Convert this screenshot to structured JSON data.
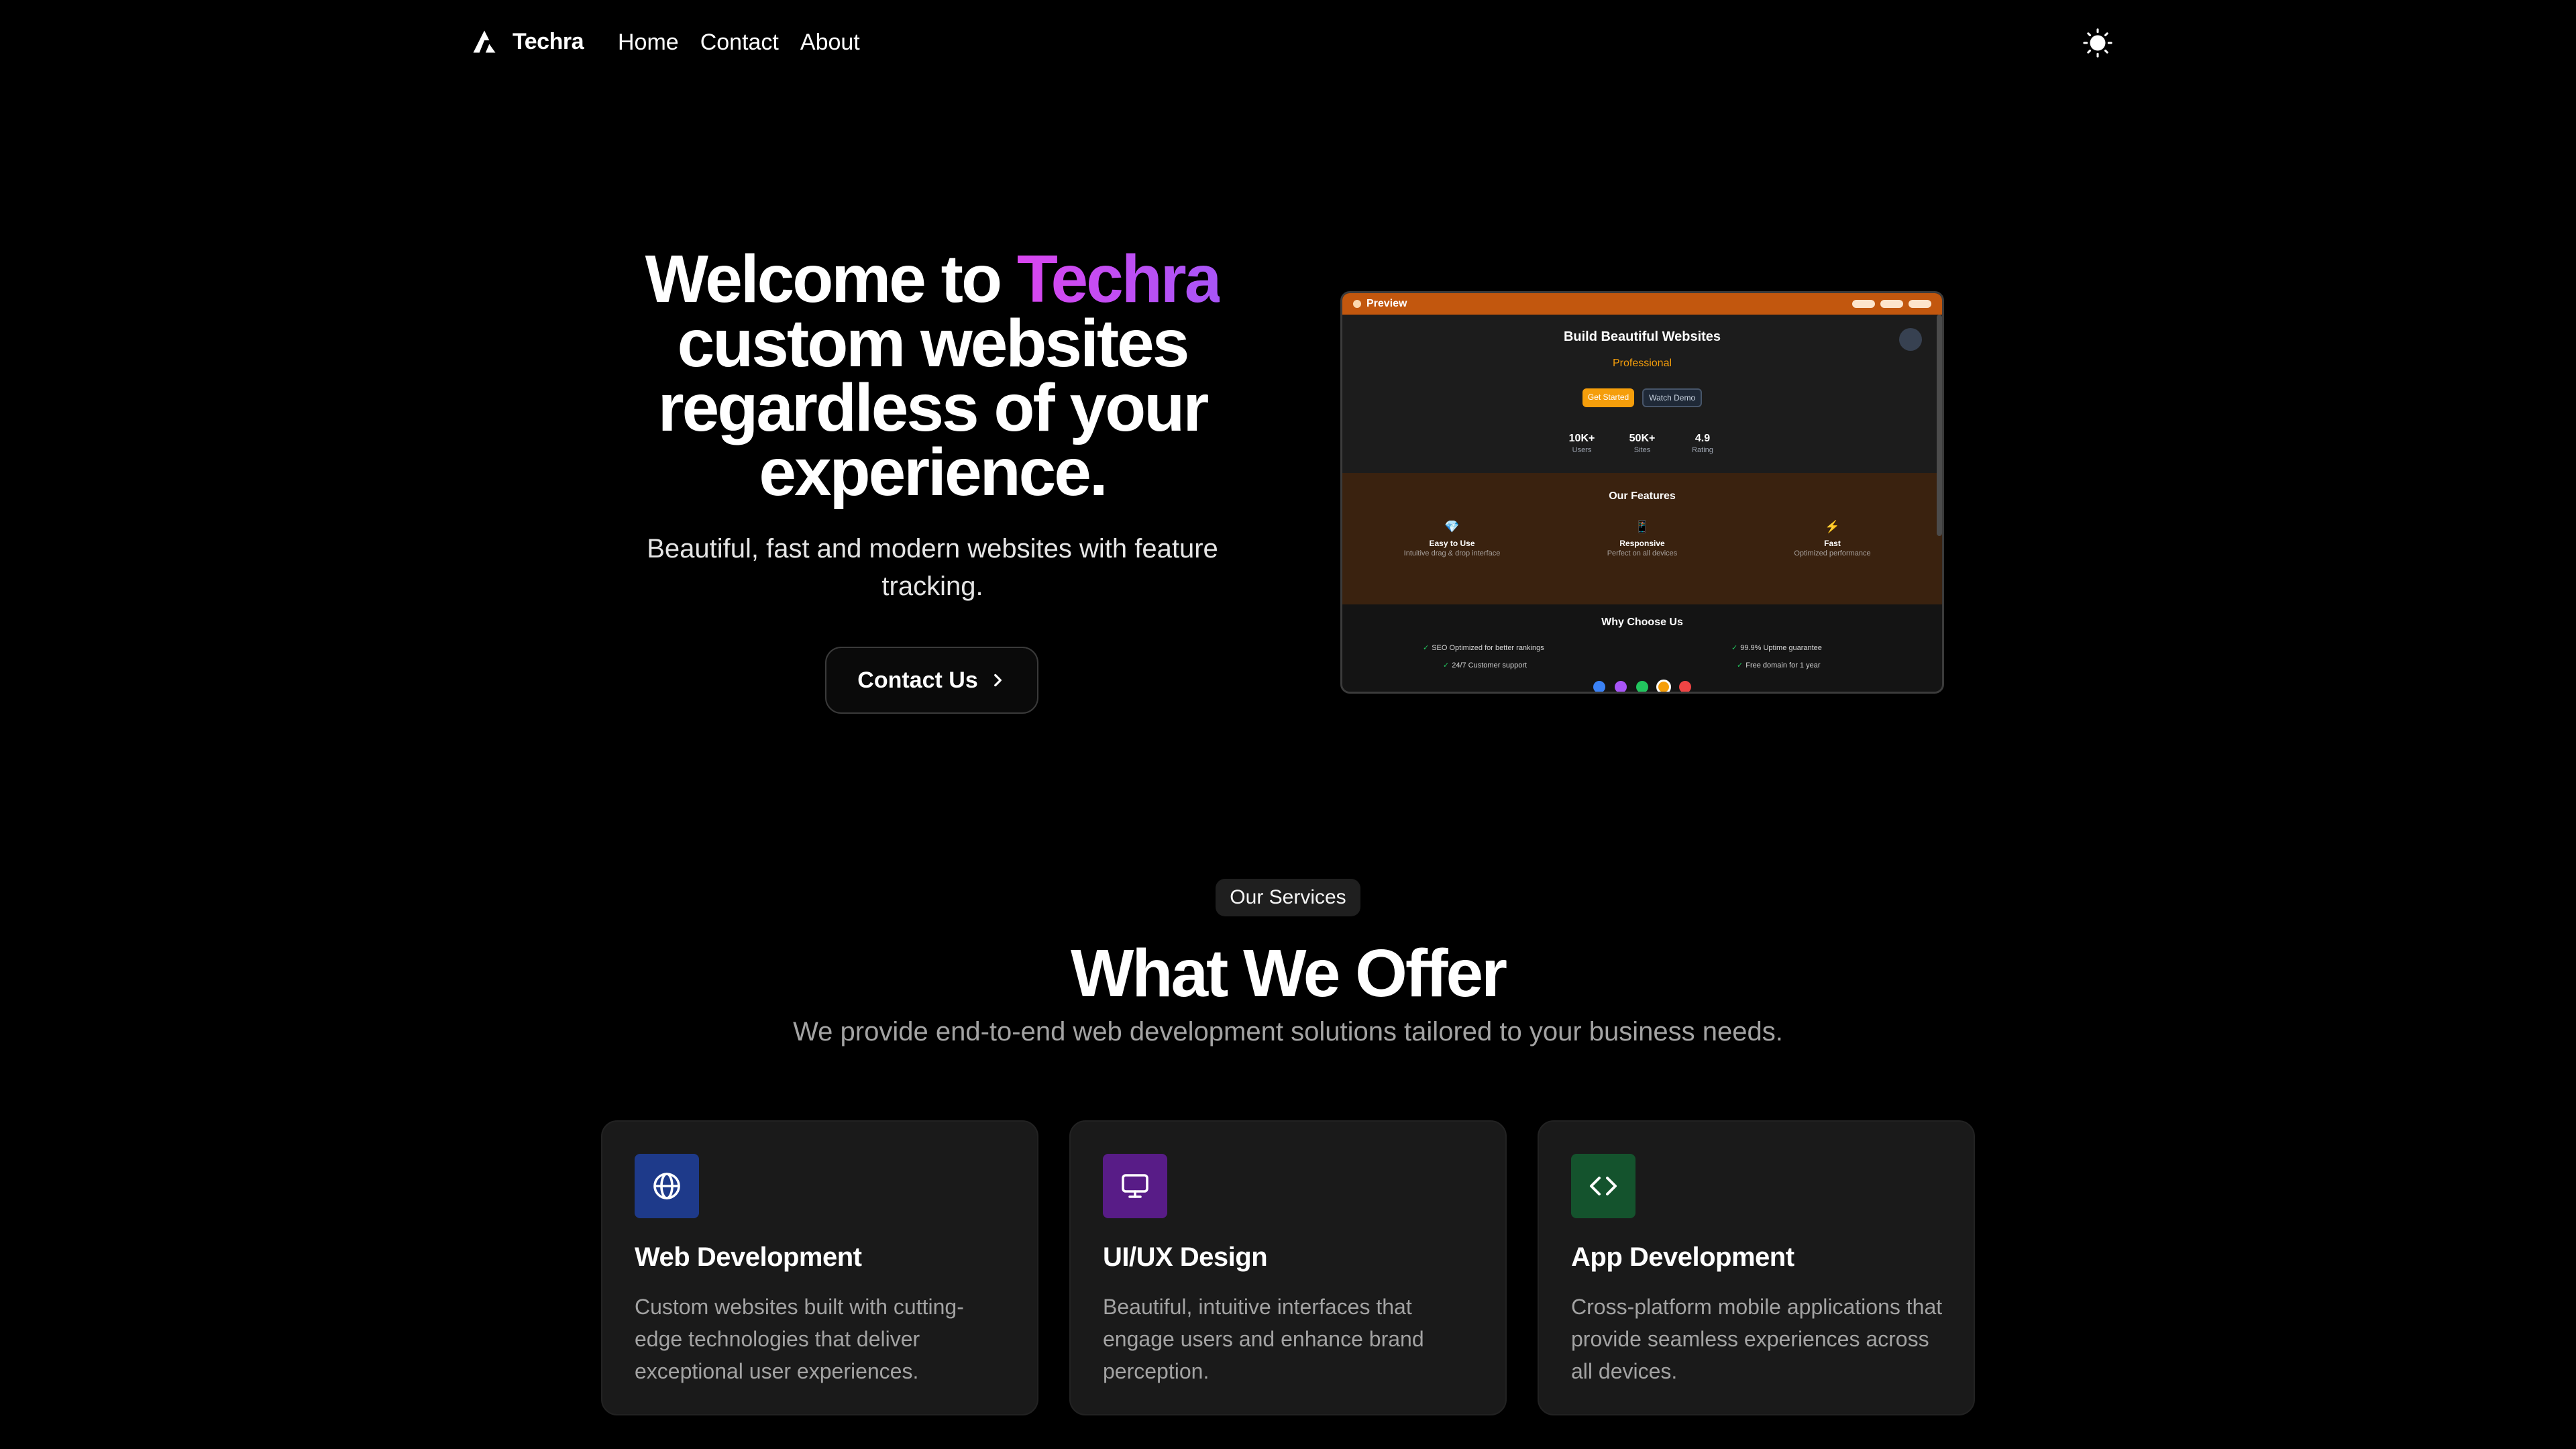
{
  "nav": {
    "brand": "Techra",
    "links": [
      "Home",
      "Contact",
      "About"
    ],
    "icons": {
      "logo": "techra-logo-icon",
      "theme": "sun-icon"
    }
  },
  "hero": {
    "title_prefix": "Welcome to ",
    "title_accent": "Techra",
    "title_rest": "custom websites regardless of your experience.",
    "subtitle": "Beautiful, fast and modern websites with feature tracking.",
    "cta_label": "Contact Us",
    "accent_color": "#d946ef"
  },
  "preview": {
    "window_title": "Preview",
    "heading": "Build Beautiful Websites",
    "typed_word": "Professional",
    "primary_btn": "Get Started",
    "secondary_btn": "Watch Demo",
    "stats": [
      {
        "value": "10K+",
        "label": "Users"
      },
      {
        "value": "50K+",
        "label": "Sites"
      },
      {
        "value": "4.9",
        "label": "Rating"
      }
    ],
    "features_heading": "Our Features",
    "features": [
      {
        "icon": "💎",
        "title": "Easy to Use",
        "desc": "Intuitive drag & drop interface"
      },
      {
        "icon": "📱",
        "title": "Responsive",
        "desc": "Perfect on all devices"
      },
      {
        "icon": "⚡",
        "title": "Fast",
        "desc": "Optimized performance"
      }
    ],
    "why_heading": "Why Choose Us",
    "why_left": [
      "SEO Optimized for better rankings",
      "24/7 Customer support"
    ],
    "why_right": [
      "99.9% Uptime guarantee",
      "Free domain for 1 year"
    ],
    "theme_colors": [
      "#3b82f6",
      "#a855f7",
      "#22c55e",
      "#f59e0b",
      "#ef4444"
    ],
    "selected_theme": 3
  },
  "services": {
    "badge": "Our Services",
    "title": "What We Offer",
    "subtitle": "We provide end-to-end web development solutions tailored to your business needs.",
    "cards": [
      {
        "title": "Web Development",
        "desc": "Custom websites built with cutting-edge technologies that deliver exceptional user experiences.",
        "icon": "globe-icon",
        "color": "#1e3a8a"
      },
      {
        "title": "UI/UX Design",
        "desc": "Beautiful, intuitive interfaces that engage users and enhance brand perception.",
        "icon": "monitor-icon",
        "color": "#581c87"
      },
      {
        "title": "App Development",
        "desc": "Cross-platform mobile applications that provide seamless experiences across all devices.",
        "icon": "code-icon",
        "color": "#14532d"
      }
    ]
  }
}
